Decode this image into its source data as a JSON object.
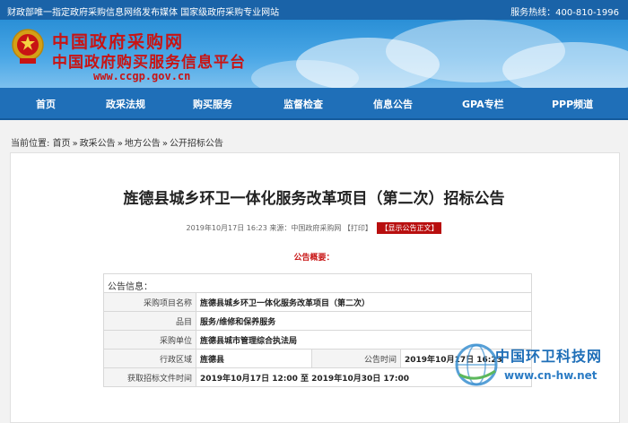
{
  "topbar": {
    "left_text": "财政部唯一指定政府采购信息网络发布媒体 国家级政府采购专业网站",
    "hotline": "服务热线：400-810-1996"
  },
  "banner": {
    "logo_title": "中国政府采购网",
    "logo_subtitle": "中国政府购买服务信息平台",
    "logo_url": "www.ccgp.gov.cn"
  },
  "nav": {
    "items": [
      "首页",
      "政采法规",
      "购买服务",
      "监督检查",
      "信息公告",
      "GPA专栏",
      "PPP频道"
    ]
  },
  "breadcrumb": {
    "prefix": "当前位置:",
    "items": [
      "首页",
      "政采公告",
      "地方公告",
      "公开招标公告"
    ],
    "separator": "»"
  },
  "article": {
    "title": "旌德县城乡环卫一体化服务改革项目（第二次）招标公告",
    "meta": "2019年10月17日 16:23 来源：中国政府采购网 【打印】",
    "show_body_button": "【显示公告正文】",
    "subheading": "公告概要：",
    "info_header": "公告信息：",
    "rows": [
      {
        "label": "采购项目名称",
        "value": "旌德县城乡环卫一体化服务改革项目（第二次）"
      },
      {
        "label": "品目",
        "value": "服务/维修和保养服务"
      },
      {
        "label": "采购单位",
        "value": "旌德县城市管理综合执法局"
      },
      {
        "label": "行政区域",
        "value": "旌德县",
        "label2": "公告时间",
        "value2": "2019年10月17日 16:23"
      },
      {
        "label": "获取招标文件时间",
        "value": "2019年10月17日 12:00  至  2019年10月30日 17:00"
      }
    ]
  },
  "watermark": {
    "name": "中国环卫科技网",
    "url": "www.cn-hw.net"
  },
  "colors": {
    "nav_blue": "#1f6fb8",
    "brand_red": "#c81414",
    "topbar_blue": "#1a63a8"
  }
}
